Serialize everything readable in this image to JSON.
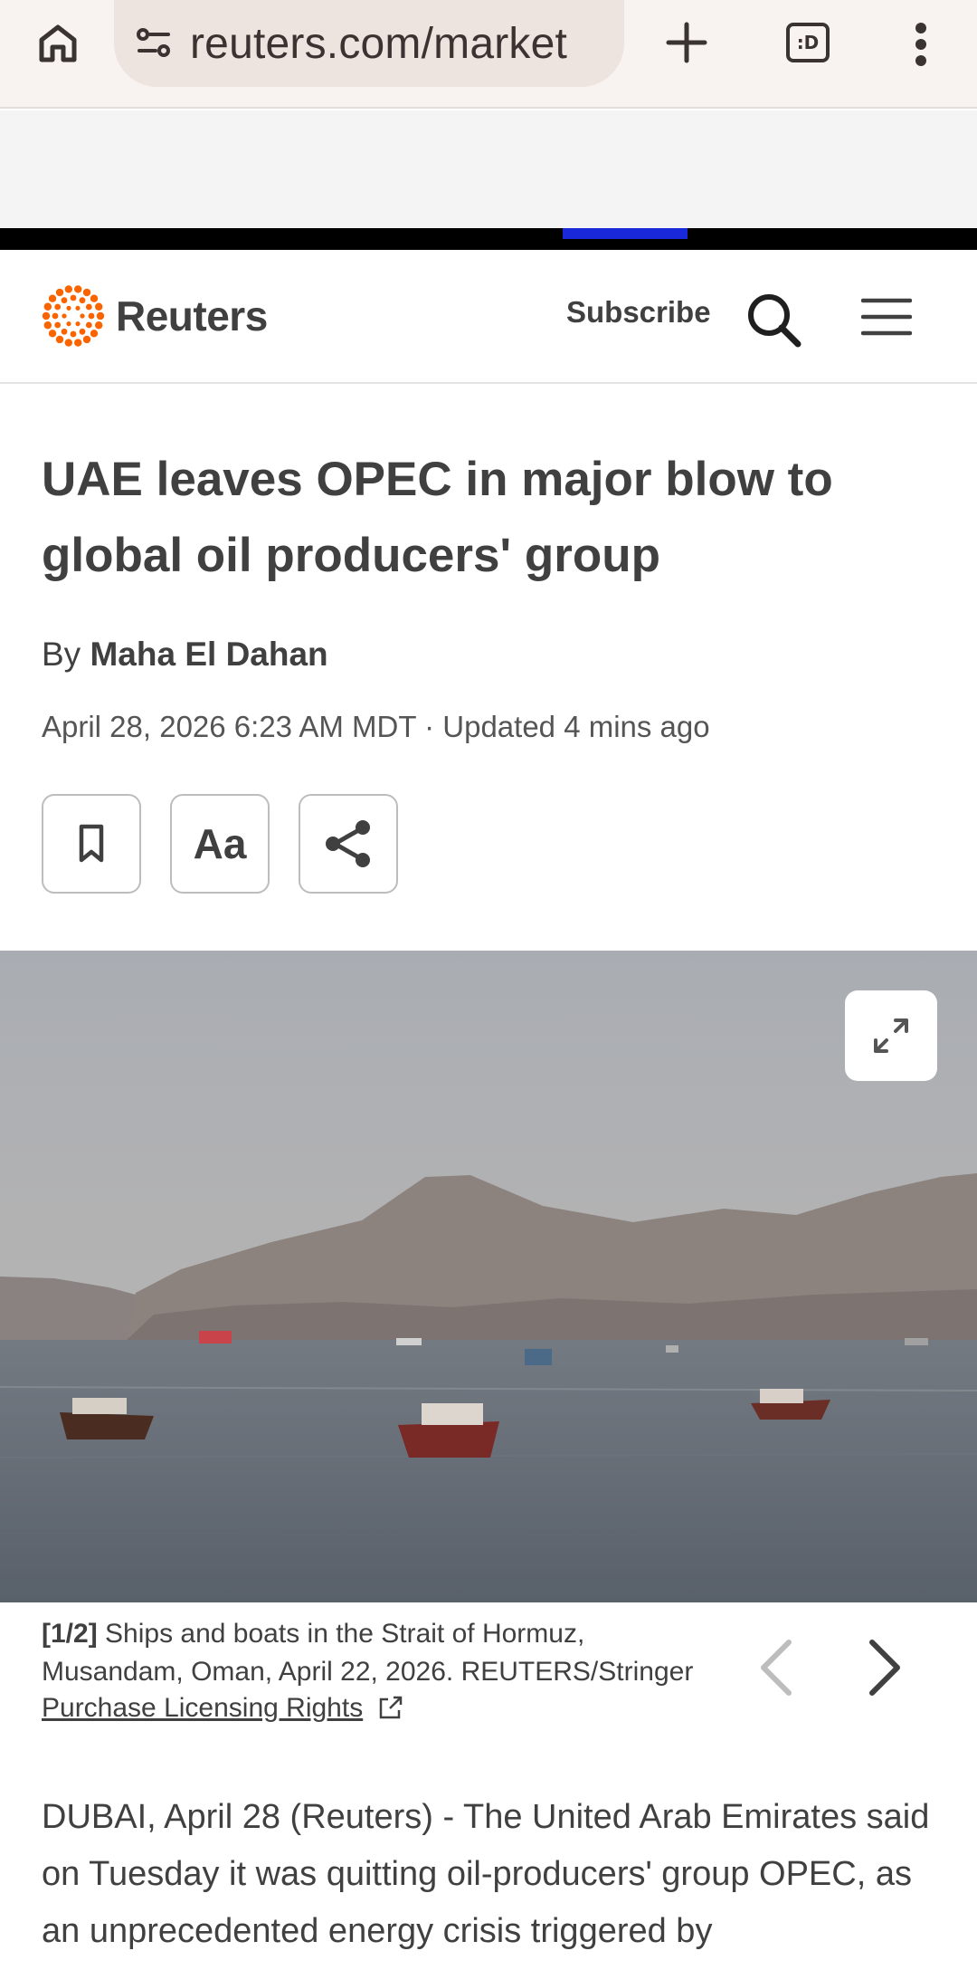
{
  "browser": {
    "url": "reuters.com/market",
    "home_icon": "home-icon",
    "site_info_icon": "tune-icon",
    "new_tab_icon": "plus-icon",
    "tabs_label": ":D",
    "menu_icon": "more-vert-icon"
  },
  "header": {
    "logo_text": "Reuters",
    "subscribe_label": "Subscribe",
    "search_icon": "search-icon",
    "menu_icon": "hamburger-icon",
    "brand_color": "#fa6400"
  },
  "article": {
    "headline": "UAE leaves OPEC in major blow to global oil producers' group",
    "byline_prefix": "By",
    "author": "Maha El Dahan",
    "dateline": "April 28, 2026 6:23 AM MDT · Updated 4 mins ago",
    "tools": {
      "bookmark_icon": "bookmark-icon",
      "text_size_label": "Aa",
      "share_icon": "share-icon"
    },
    "photo": {
      "expand_icon": "expand-icon",
      "counter": "[1/2]",
      "caption": "Ships and boats in the Strait of Hormuz, Musandam, Oman, April 22, 2026. REUTERS/Stringer",
      "license_label": "Purchase Licensing Rights",
      "prev_icon": "chevron-left-icon",
      "next_icon": "chevron-right-icon"
    },
    "body_start": "DUBAI, April 28 (Reuters) - The United Arab Emirates said on Tuesday it was quitting oil-producers' group OPEC, as an unprecedented energy crisis triggered by"
  }
}
